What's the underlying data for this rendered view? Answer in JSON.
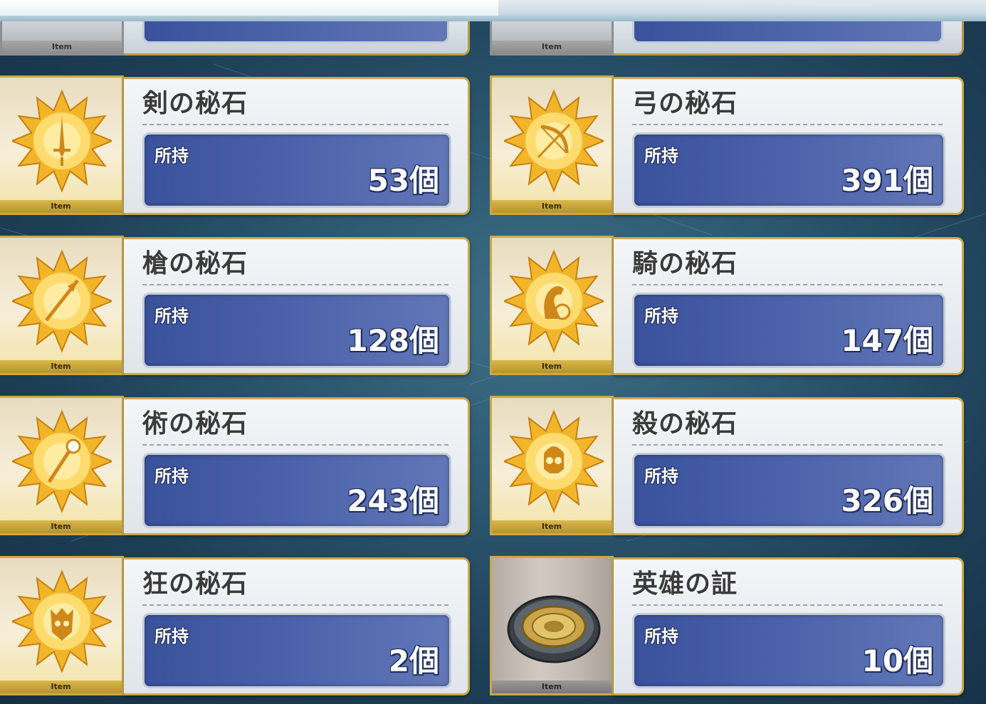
{
  "tag_label": "Item",
  "held_label": "所持",
  "partial_row": [
    {
      "tag": "Item"
    },
    {
      "tag": "Item"
    }
  ],
  "items": [
    {
      "name": "剣の秘石",
      "count": "53個",
      "icon": "saber-sword-star-icon",
      "kind": "star"
    },
    {
      "name": "弓の秘石",
      "count": "391個",
      "icon": "archer-bow-star-icon",
      "kind": "star"
    },
    {
      "name": "槍の秘石",
      "count": "128個",
      "icon": "lancer-spear-star-icon",
      "kind": "star"
    },
    {
      "name": "騎の秘石",
      "count": "147個",
      "icon": "rider-horse-star-icon",
      "kind": "star"
    },
    {
      "name": "術の秘石",
      "count": "243個",
      "icon": "caster-staff-star-icon",
      "kind": "star"
    },
    {
      "name": "殺の秘石",
      "count": "326個",
      "icon": "assassin-skull-star-icon",
      "kind": "star"
    },
    {
      "name": "狂の秘石",
      "count": "2個",
      "icon": "berserker-beast-star-icon",
      "kind": "star"
    },
    {
      "name": "英雄の証",
      "count": "10個",
      "icon": "hero-proof-medallion-icon",
      "kind": "medallion"
    }
  ],
  "colors": {
    "gold_border": "#c9a94a",
    "count_box": "#4c63ab",
    "name_text": "#3b3b3b"
  }
}
